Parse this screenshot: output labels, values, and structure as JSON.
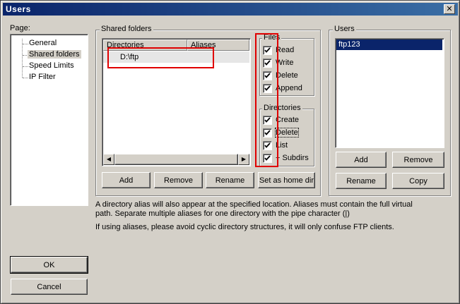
{
  "window": {
    "title": "Users",
    "close_label": "✕"
  },
  "page_panel": {
    "label": "Page:",
    "items": [
      {
        "label": "General",
        "selected": false
      },
      {
        "label": "Shared folders",
        "selected": true
      },
      {
        "label": "Speed Limits",
        "selected": false
      },
      {
        "label": "IP Filter",
        "selected": false
      }
    ]
  },
  "shared_folders": {
    "label": "Shared folders",
    "columns": {
      "directories": "Directories",
      "aliases": "Aliases"
    },
    "rows": [
      {
        "directory": "D:\\ftp",
        "alias": ""
      }
    ],
    "buttons": {
      "add": "Add",
      "remove": "Remove",
      "rename": "Rename",
      "set_home": "Set as home dir"
    }
  },
  "files": {
    "label": "Files",
    "options": [
      {
        "label": "Read",
        "checked": true
      },
      {
        "label": "Write",
        "checked": true
      },
      {
        "label": "Delete",
        "checked": true
      },
      {
        "label": "Append",
        "checked": true
      }
    ]
  },
  "directories": {
    "label": "Directories",
    "options": [
      {
        "label": "Create",
        "checked": true
      },
      {
        "label": "Delete",
        "checked": true
      },
      {
        "label": "List",
        "checked": true
      },
      {
        "label": "+ Subdirs",
        "checked": true
      }
    ]
  },
  "users": {
    "label": "Users",
    "list": [
      {
        "name": "ftp123",
        "selected": true
      }
    ],
    "buttons": {
      "add": "Add",
      "remove": "Remove",
      "rename": "Rename",
      "copy": "Copy"
    }
  },
  "info": {
    "line1": "A directory alias will also appear at the specified location. Aliases must contain the full virtual",
    "line2": "path. Separate multiple aliases for one directory with the pipe character (|)",
    "line3": "If using aliases, please avoid cyclic directory structures, it will only confuse FTP clients."
  },
  "dialog_buttons": {
    "ok": "OK",
    "cancel": "Cancel"
  },
  "colors": {
    "selection": "#0a246a",
    "annotation_red": "#e00000",
    "face": "#d4d0c8"
  }
}
